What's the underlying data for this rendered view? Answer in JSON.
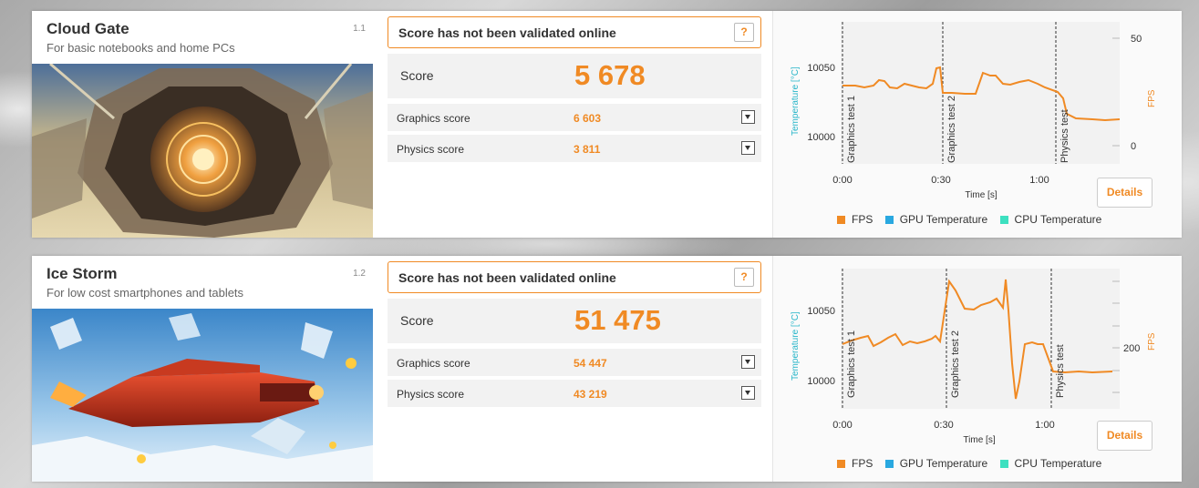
{
  "colors": {
    "accent": "#f08a24",
    "gpu": "#29a8e0",
    "cpu": "#3de0c0",
    "axis_left": "#29b6c9"
  },
  "benchmarks": [
    {
      "title": "Cloud Gate",
      "subtitle": "For basic notebooks and home PCs",
      "version": "1.1",
      "validation_text": "Score has not been validated online",
      "help_label": "?",
      "score_label": "Score",
      "score_value": "5 678",
      "sub_scores": [
        {
          "label": "Graphics score",
          "value": "6 603"
        },
        {
          "label": "Physics score",
          "value": "3 811"
        }
      ],
      "details_label": "Details",
      "chart": {
        "y_left_label": "Temperature [°C]",
        "y_left_ticks": [
          "10050",
          "10000"
        ],
        "y_right_label": "FPS",
        "y_right_ticks": [
          "50",
          "0"
        ],
        "x_label": "Time [s]",
        "x_ticks": [
          "0:00",
          "0:30",
          "1:00"
        ],
        "sections": [
          "Graphics test 1",
          "Graphics test 2",
          "Physics test"
        ],
        "legend": [
          "FPS",
          "GPU Temperature",
          "CPU Temperature"
        ]
      }
    },
    {
      "title": "Ice Storm",
      "subtitle": "For low cost smartphones and tablets",
      "version": "1.2",
      "validation_text": "Score has not been validated online",
      "help_label": "?",
      "score_label": "Score",
      "score_value": "51 475",
      "sub_scores": [
        {
          "label": "Graphics score",
          "value": "54 447"
        },
        {
          "label": "Physics score",
          "value": "43 219"
        }
      ],
      "details_label": "Details",
      "chart": {
        "y_left_label": "Temperature [°C]",
        "y_left_ticks": [
          "10050",
          "10000"
        ],
        "y_right_label": "FPS",
        "y_right_ticks": [
          "200"
        ],
        "x_label": "Time [s]",
        "x_ticks": [
          "0:00",
          "0:30",
          "1:00"
        ],
        "sections": [
          "Graphics test 1",
          "Graphics test 2",
          "Physics test"
        ],
        "legend": [
          "FPS",
          "GPU Temperature",
          "CPU Temperature"
        ]
      }
    }
  ]
}
